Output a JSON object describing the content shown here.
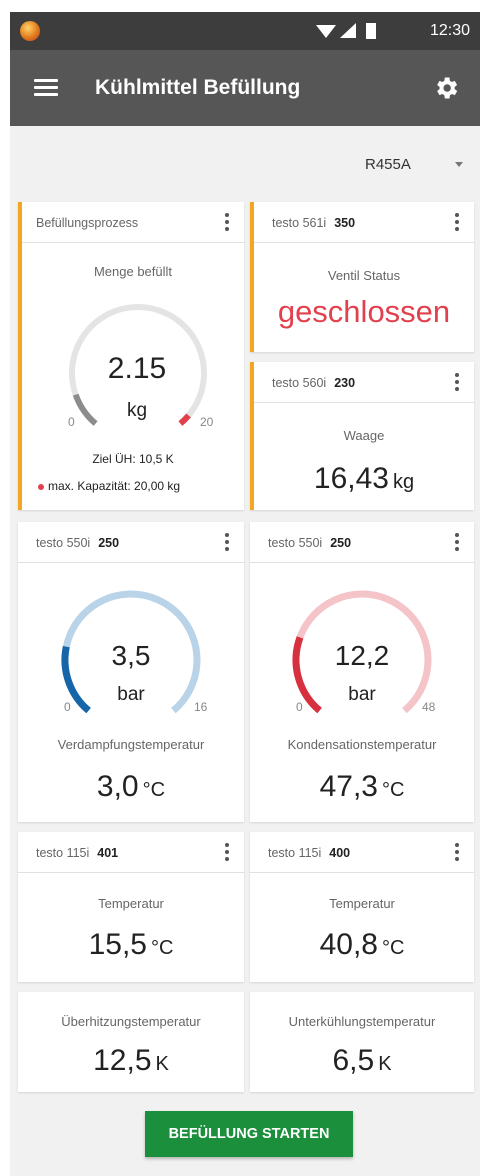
{
  "statusbar": {
    "time": "12:30"
  },
  "toolbar": {
    "title": "Kühlmittel Befüllung"
  },
  "refrigerant": {
    "selected": "R455A"
  },
  "filling_card": {
    "header": "Befüllungsprozess",
    "label": "Menge befüllt",
    "value": "2.15",
    "unit": "kg",
    "min": "0",
    "max": "20",
    "fill_fraction": 0.11,
    "target": "Ziel ÜH: 10,5 K",
    "capacity": "max. Kapazität: 20,00 kg",
    "accent_color": "#f2a623"
  },
  "valve_card": {
    "device": "testo 561i",
    "id": "350",
    "label": "Ventil Status",
    "status": "geschlossen",
    "status_color": "#e2404d"
  },
  "scale_card": {
    "device": "testo 560i",
    "id": "230",
    "label": "Waage",
    "value": "16,43",
    "unit": "kg"
  },
  "low_pressure_card": {
    "device": "testo 550i",
    "id": "250",
    "value": "3,5",
    "unit": "bar",
    "min": "0",
    "max": "16",
    "fill_fraction": 0.22,
    "color": "#1565a8",
    "label": "Verdampfungstemperatur",
    "temp_value": "3,0",
    "temp_unit": "°C"
  },
  "high_pressure_card": {
    "device": "testo 550i",
    "id": "250",
    "value": "12,2",
    "unit": "bar",
    "min": "0",
    "max": "48",
    "fill_fraction": 0.25,
    "color": "#d7303f",
    "label": "Kondensationstemperatur",
    "temp_value": "47,3",
    "temp_unit": "°C"
  },
  "temp_card_left": {
    "device": "testo 115i",
    "id": "401",
    "label": "Temperatur",
    "value": "15,5",
    "unit": "°C"
  },
  "temp_card_right": {
    "device": "testo 115i",
    "id": "400",
    "label": "Temperatur",
    "value": "40,8",
    "unit": "°C"
  },
  "superheat_card": {
    "label": "Überhitzungstemperatur",
    "value": "12,5",
    "unit": "K"
  },
  "subcool_card": {
    "label": "Unterkühlungstemperatur",
    "value": "6,5",
    "unit": "K"
  },
  "start_button": {
    "label": "BEFÜLLUNG STARTEN",
    "color": "#1b8f3c"
  }
}
